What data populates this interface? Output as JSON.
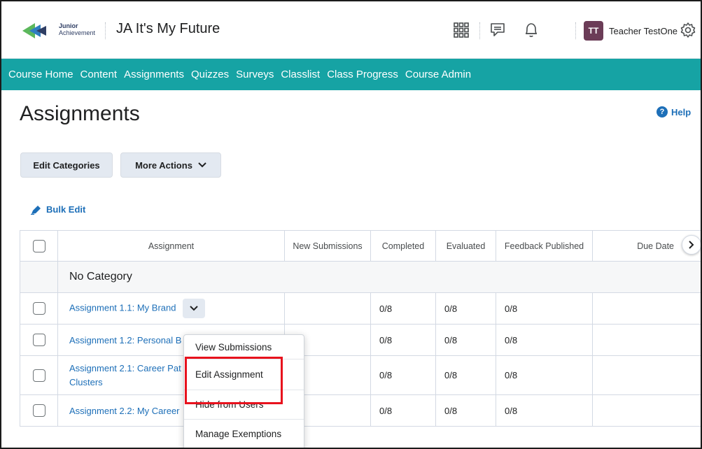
{
  "header": {
    "logo_line1": "Junior",
    "logo_line2": "Achievement",
    "course_title": "JA It's My Future",
    "user_initials": "TT",
    "user_name": "Teacher TestOne"
  },
  "nav": {
    "items": [
      "Course Home",
      "Content",
      "Assignments",
      "Quizzes",
      "Surveys",
      "Classlist",
      "Class Progress",
      "Course Admin"
    ]
  },
  "page": {
    "title": "Assignments",
    "help_label": "Help",
    "edit_categories_label": "Edit Categories",
    "more_actions_label": "More Actions",
    "bulk_edit_label": "Bulk Edit"
  },
  "table": {
    "columns": [
      "Assignment",
      "New Submissions",
      "Completed",
      "Evaluated",
      "Feedback Published",
      "Due Date"
    ],
    "category_label": "No Category",
    "rows": [
      {
        "name": "Assignment 1.1: My Brand",
        "new": "",
        "completed": "0/8",
        "evaluated": "0/8",
        "feedback": "0/8",
        "due": ""
      },
      {
        "name": "Assignment 1.2: Personal B",
        "new": "",
        "completed": "0/8",
        "evaluated": "0/8",
        "feedback": "0/8",
        "due": ""
      },
      {
        "name": "Assignment 2.1: Career Pat",
        "name2": "Clusters",
        "new": "",
        "completed": "0/8",
        "evaluated": "0/8",
        "feedback": "0/8",
        "due": ""
      },
      {
        "name": "Assignment 2.2: My Career",
        "new": "",
        "completed": "0/8",
        "evaluated": "0/8",
        "feedback": "0/8",
        "due": ""
      }
    ]
  },
  "context_menu": {
    "items": [
      "View Submissions",
      "Edit Assignment",
      "Hide from Users",
      "Manage Exemptions"
    ]
  },
  "colors": {
    "nav_bg": "#16a3a4",
    "link": "#1d6fb8",
    "avatar_bg": "#6b3c57",
    "highlight": "#e8121d"
  }
}
